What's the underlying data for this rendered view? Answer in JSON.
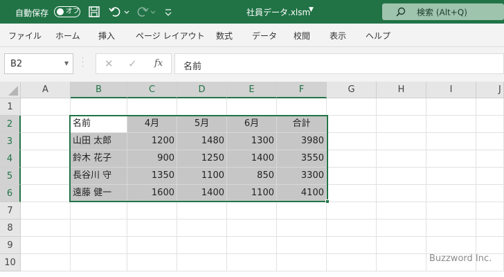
{
  "titlebar": {
    "autosave_label": "自動保存",
    "autosave_state": "オフ",
    "filename": "社員データ.xlsm",
    "search_placeholder": "検索 (Alt+Q)"
  },
  "menu": [
    "ファイル",
    "ホーム",
    "挿入",
    "ページ レイアウト",
    "数式",
    "データ",
    "校閲",
    "表示",
    "ヘルプ"
  ],
  "namebox": "B2",
  "formula": "名前",
  "columns": [
    "A",
    "B",
    "C",
    "D",
    "E",
    "F",
    "G",
    "H",
    "I",
    "J"
  ],
  "rows": [
    "1",
    "2",
    "3",
    "4",
    "5",
    "6",
    "7",
    "8",
    "9",
    "10"
  ],
  "table": {
    "headers": [
      "名前",
      "4月",
      "5月",
      "6月",
      "合計"
    ],
    "rows": [
      [
        "山田 太郎",
        "1200",
        "1480",
        "1300",
        "3980"
      ],
      [
        "鈴木 花子",
        "900",
        "1250",
        "1400",
        "3550"
      ],
      [
        "長谷川 守",
        "1350",
        "1100",
        "850",
        "3300"
      ],
      [
        "遠藤 健一",
        "1600",
        "1400",
        "1100",
        "4100"
      ]
    ]
  },
  "watermark": "Buzzword Inc.",
  "colors": {
    "accent": "#217346",
    "selection_fill": "#c6c6c6"
  }
}
